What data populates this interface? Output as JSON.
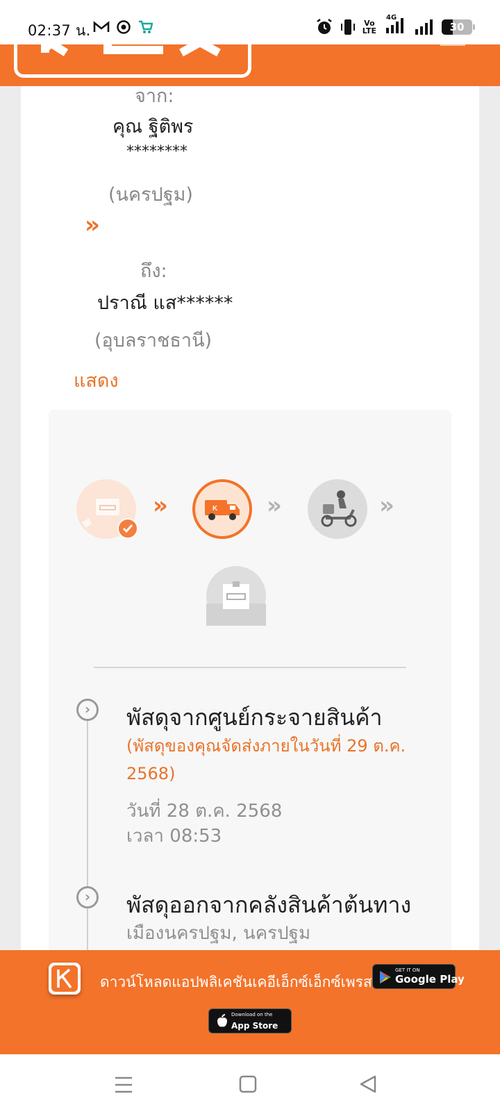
{
  "status_bar": {
    "time": "02:37 น.",
    "icons": [
      "gmail-icon",
      "chrome-icon",
      "shop-icon"
    ],
    "volte_top": "Vo",
    "volte_bottom": "LTE",
    "network": "4G",
    "battery_level": "30"
  },
  "header": {
    "logo_text": "KEX"
  },
  "sender": {
    "label": "จาก:",
    "name": "คุณ ฐิติพร",
    "phone": "********",
    "province": "(นครปฐม)"
  },
  "receiver": {
    "label": "ถึง:",
    "name": "ปราณี แส******",
    "province": "(อุบลราชธานี)"
  },
  "show_link": "แสดง",
  "steps": [
    {
      "name": "picked-up",
      "state": "done"
    },
    {
      "name": "in-transit",
      "state": "current"
    },
    {
      "name": "out-for-delivery",
      "state": "pending"
    },
    {
      "name": "delivered",
      "state": "pending"
    }
  ],
  "events": [
    {
      "title": "พัสดุจากศูนย์กระจายสินค้า",
      "note": "(พัสดุของคุณจัดส่งภายในวันที่ 29 ต.ค. 2568)",
      "date": "วันที่ 28 ต.ค. 2568",
      "time": "เวลา 08:53"
    },
    {
      "title": "พัสดุออกจากคลังสินค้าต้นทาง",
      "location": "เมืองนครปฐม, นครปฐม"
    }
  ],
  "banner": {
    "text": "ดาวน์โหลดแอปพลิเคชันเคอีเอ็กซ์เอ็กซ์เพรส",
    "google_play_small": "GET IT ON",
    "google_play_big": "Google Play",
    "app_store_small": "Download on the",
    "app_store_big": "App Store"
  },
  "colors": {
    "brand": "#f3732a",
    "text": "#222222",
    "muted": "#909090"
  }
}
